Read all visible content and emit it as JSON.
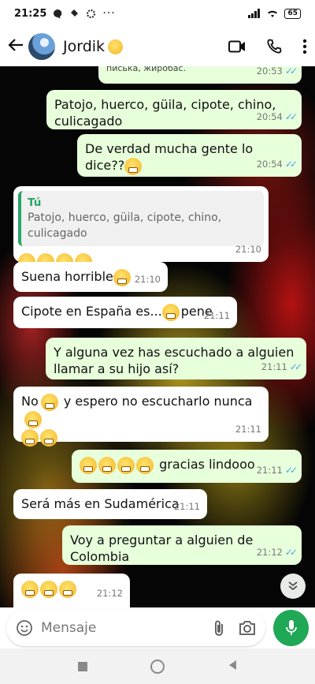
{
  "status_bar": {
    "time": "21:25",
    "battery": "65"
  },
  "header": {
    "contact_name": "Jordik"
  },
  "messages": {
    "m0": {
      "text": "писька, жиробас.",
      "time": "20:53"
    },
    "m1": {
      "text": "Patojo, huerco, güila, cipote, chino, culicagado",
      "time": "20:54"
    },
    "m2": {
      "text": "De verdad mucha gente lo dice??",
      "time": "20:54"
    },
    "m3": {
      "quote_author": "Tú",
      "quote_text": "Patojo, huerco, güila, cipote, chino, culicagado",
      "time": "21:10"
    },
    "m4": {
      "text": "Suena horrible",
      "time": "21:10"
    },
    "m5": {
      "text_a": "Cipote en España es...",
      "text_b": "pene",
      "time": "21:11"
    },
    "m6": {
      "text": "Y alguna vez has escuchado a alguien llamar a su hijo así?",
      "time": "21:11"
    },
    "m7": {
      "text_a": "No",
      "text_b": " y espero no escucharlo nunca",
      "time": "21:11"
    },
    "m8": {
      "text": " gracias lindooo",
      "time": "21:11"
    },
    "m9": {
      "text": "Será más en Sudamérica",
      "time": "21:11"
    },
    "m10": {
      "text": "Voy a preguntar a alguien de Colombia",
      "time": "21:12"
    },
    "m11": {
      "time": "21:12"
    }
  },
  "composer": {
    "placeholder": "Mensaje"
  },
  "icons": [
    "back-arrow-icon",
    "video-call-icon",
    "phone-icon",
    "more-options-icon",
    "emoji-icon",
    "attach-icon",
    "camera-icon",
    "mic-icon",
    "scroll-down-icon"
  ],
  "colors": {
    "outgoing_bubble": "#e7ffdb",
    "incoming_bubble": "#ffffff",
    "accent_green": "#1fa855",
    "read_ticks": "#4fa6e8"
  }
}
